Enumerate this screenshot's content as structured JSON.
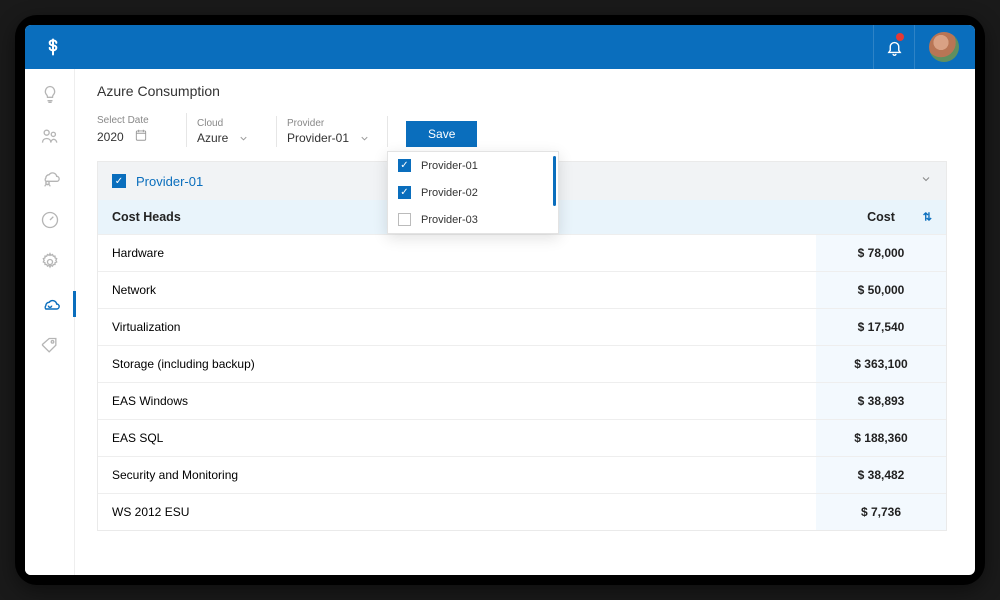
{
  "page": {
    "title": "Azure Consumption"
  },
  "filters": {
    "date": {
      "label": "Select Date",
      "value": "2020"
    },
    "cloud": {
      "label": "Cloud",
      "value": "Azure"
    },
    "provider": {
      "label": "Provider",
      "value": "Provider-01"
    },
    "save_label": "Save"
  },
  "provider_dropdown": {
    "options": [
      {
        "label": "Provider-01",
        "checked": true
      },
      {
        "label": "Provider-02",
        "checked": true
      },
      {
        "label": "Provider-03",
        "checked": false
      }
    ]
  },
  "panel": {
    "title": "Provider-01",
    "checked": true
  },
  "table": {
    "columns": {
      "heads": "Cost Heads",
      "cost": "Cost"
    },
    "rows": [
      {
        "head": "Hardware",
        "cost": "$ 78,000"
      },
      {
        "head": "Network",
        "cost": "$ 50,000"
      },
      {
        "head": "Virtualization",
        "cost": "$ 17,540"
      },
      {
        "head": "Storage (including backup)",
        "cost": "$ 363,100"
      },
      {
        "head": "EAS Windows",
        "cost": "$ 38,893"
      },
      {
        "head": "EAS SQL",
        "cost": "$ 188,360"
      },
      {
        "head": "Security and Monitoring",
        "cost": "$ 38,482"
      },
      {
        "head": "WS 2012 ESU",
        "cost": "$ 7,736"
      }
    ]
  }
}
